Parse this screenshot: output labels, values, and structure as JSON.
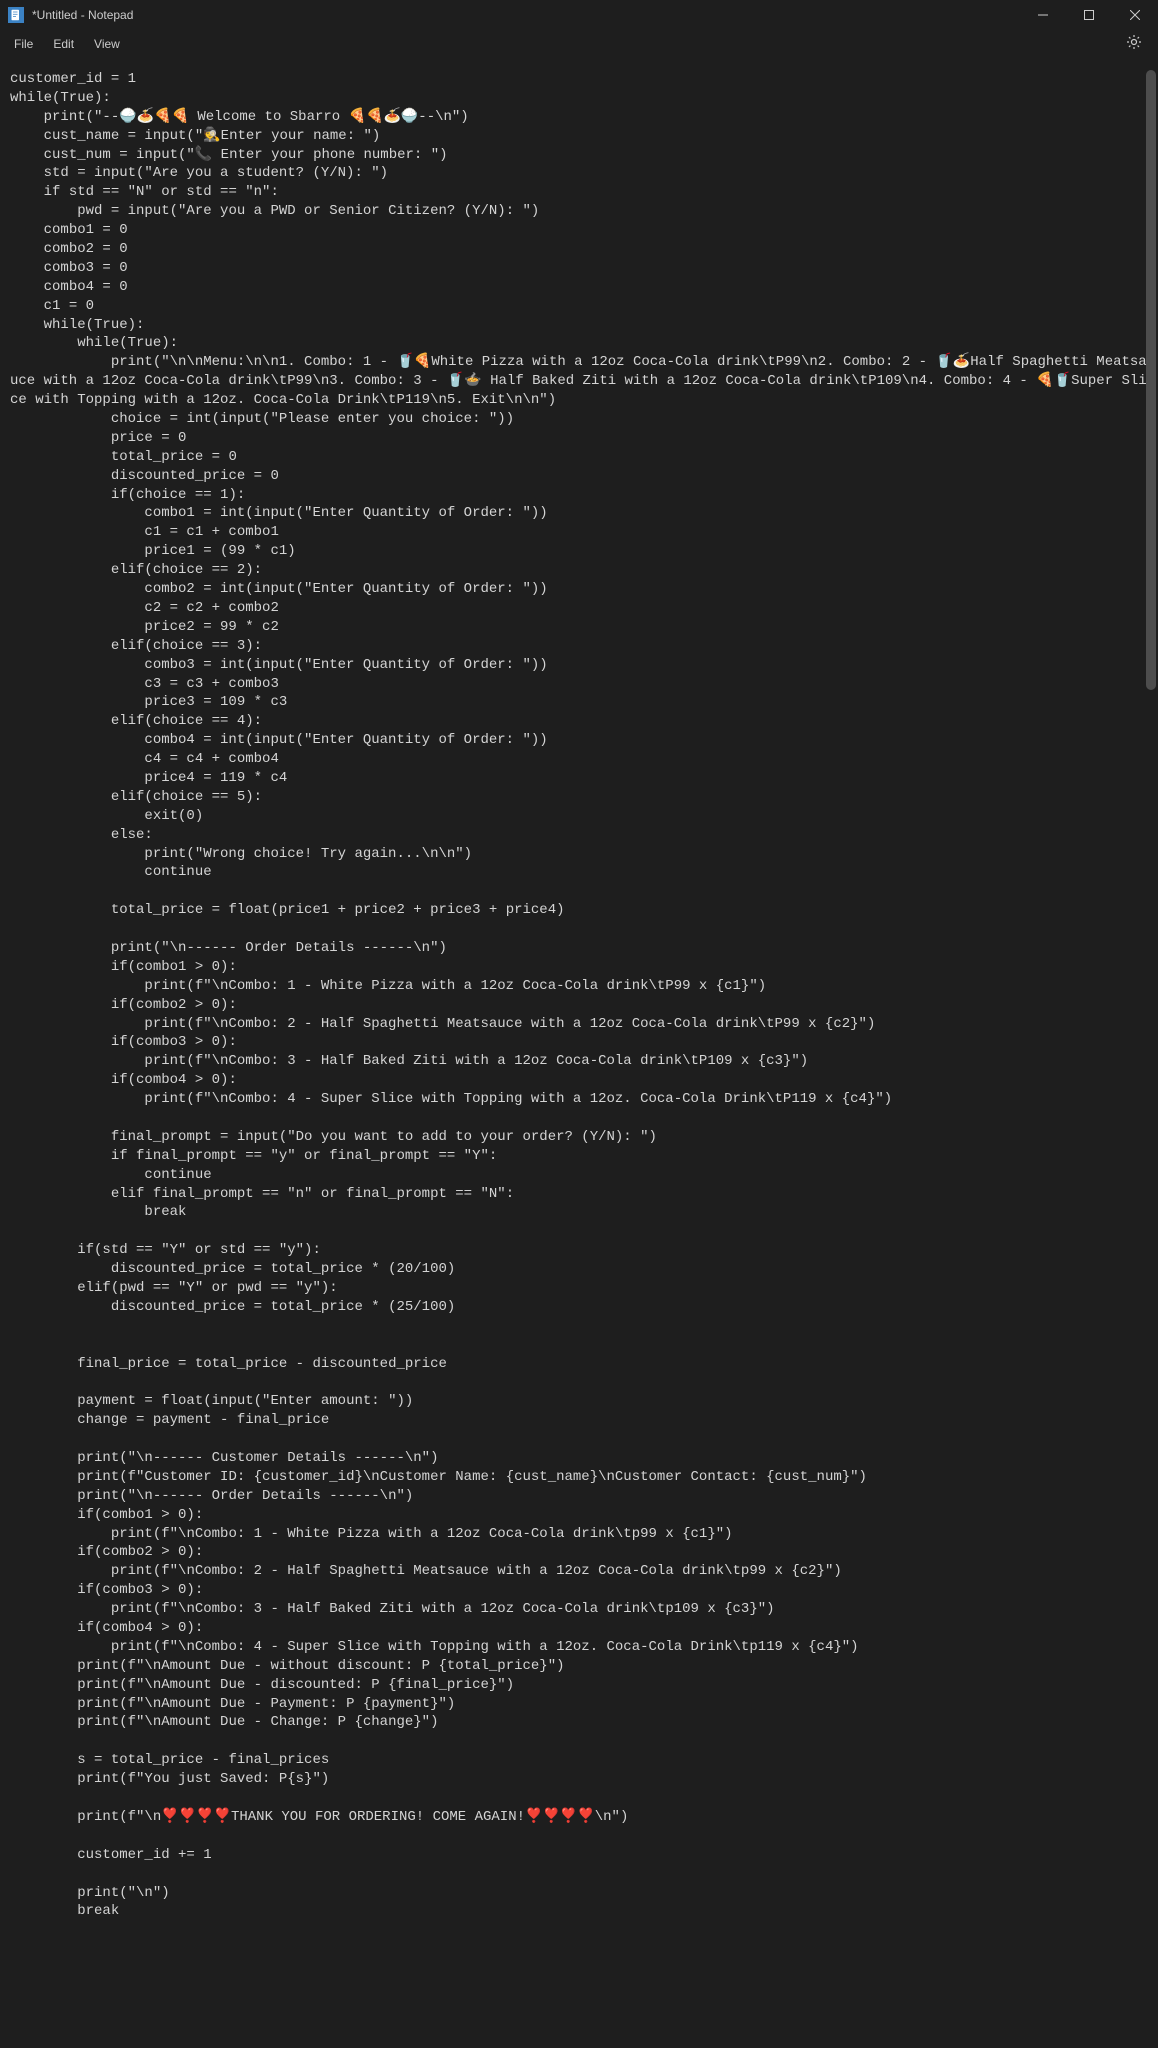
{
  "window": {
    "title": "*Untitled - Notepad"
  },
  "menu": {
    "file": "File",
    "edit": "Edit",
    "view": "View"
  },
  "code": {
    "l1": "customer_id = 1",
    "l2": "while(True):",
    "l3": "    print(\"--🍚🍝🍕🍕 Welcome to Sbarro 🍕🍕🍝🍚--\\n\")",
    "l4": "    cust_name = input(\"🕵️Enter your name: \")",
    "l5": "    cust_num = input(\"📞 Enter your phone number: \")",
    "l6": "    std = input(\"Are you a student? (Y/N): \")",
    "l7": "    if std == \"N\" or std == \"n\":",
    "l8": "        pwd = input(\"Are you a PWD or Senior Citizen? (Y/N): \")",
    "l9": "    combo1 = 0",
    "l10": "    combo2 = 0",
    "l11": "    combo3 = 0",
    "l12": "    combo4 = 0",
    "l13": "    c1 = 0",
    "l14": "    while(True):",
    "l15": "        while(True):",
    "l16": "            print(\"\\n\\nMenu:\\n\\n1. Combo: 1 - 🥤🍕White Pizza with a 12oz Coca-Cola drink\\tP99\\n2. Combo: 2 - 🥤🍝Half Spaghetti Meatsauce with a 12oz Coca-Cola drink\\tP99\\n3. Combo: 3 - 🥤🍲 Half Baked Ziti with a 12oz Coca-Cola drink\\tP109\\n4. Combo: 4 - 🍕🥤Super Slice with Topping with a 12oz. Coca-Cola Drink\\tP119\\n5. Exit\\n\\n\")",
    "l17": "            choice = int(input(\"Please enter you choice: \"))",
    "l18": "            price = 0",
    "l19": "            total_price = 0",
    "l20": "            discounted_price = 0",
    "l21": "            if(choice == 1):",
    "l22": "                combo1 = int(input(\"Enter Quantity of Order: \"))",
    "l23": "                c1 = c1 + combo1",
    "l24": "                price1 = (99 * c1)",
    "l25": "            elif(choice == 2):",
    "l26": "                combo2 = int(input(\"Enter Quantity of Order: \"))",
    "l27": "                c2 = c2 + combo2",
    "l28": "                price2 = 99 * c2",
    "l29": "            elif(choice == 3):",
    "l30": "                combo3 = int(input(\"Enter Quantity of Order: \"))",
    "l31": "                c3 = c3 + combo3",
    "l32": "                price3 = 109 * c3",
    "l33": "            elif(choice == 4):",
    "l34": "                combo4 = int(input(\"Enter Quantity of Order: \"))",
    "l35": "                c4 = c4 + combo4",
    "l36": "                price4 = 119 * c4",
    "l37": "            elif(choice == 5):",
    "l38": "                exit(0)",
    "l39": "            else:",
    "l40": "                print(\"Wrong choice! Try again...\\n\\n\")",
    "l41": "                continue",
    "l42": "",
    "l43": "            total_price = float(price1 + price2 + price3 + price4)",
    "l44": "",
    "l45": "            print(\"\\n------ Order Details ------\\n\")",
    "l46": "            if(combo1 > 0):",
    "l47": "                print(f\"\\nCombo: 1 - White Pizza with a 12oz Coca-Cola drink\\tP99 x {c1}\")",
    "l48": "            if(combo2 > 0):",
    "l49": "                print(f\"\\nCombo: 2 - Half Spaghetti Meatsauce with a 12oz Coca-Cola drink\\tP99 x {c2}\")",
    "l50": "            if(combo3 > 0):",
    "l51": "                print(f\"\\nCombo: 3 - Half Baked Ziti with a 12oz Coca-Cola drink\\tP109 x {c3}\")",
    "l52": "            if(combo4 > 0):",
    "l53": "                print(f\"\\nCombo: 4 - Super Slice with Topping with a 12oz. Coca-Cola Drink\\tP119 x {c4}\")",
    "l54": "",
    "l55": "            final_prompt = input(\"Do you want to add to your order? (Y/N): \")",
    "l56": "            if final_prompt == \"y\" or final_prompt == \"Y\":",
    "l57": "                continue",
    "l58": "            elif final_prompt == \"n\" or final_prompt == \"N\":",
    "l59": "                break",
    "l60": "",
    "l61": "        if(std == \"Y\" or std == \"y\"):",
    "l62": "            discounted_price = total_price * (20/100)",
    "l63": "        elif(pwd == \"Y\" or pwd == \"y\"):",
    "l64": "            discounted_price = total_price * (25/100)",
    "l65": "",
    "l66": "",
    "l67": "        final_price = total_price - discounted_price",
    "l68": "",
    "l69": "        payment = float(input(\"Enter amount: \"))",
    "l70": "        change = payment - final_price",
    "l71": "",
    "l72": "        print(\"\\n------ Customer Details ------\\n\")",
    "l73": "        print(f\"Customer ID: {customer_id}\\nCustomer Name: {cust_name}\\nCustomer Contact: {cust_num}\")",
    "l74": "        print(\"\\n------ Order Details ------\\n\")",
    "l75": "        if(combo1 > 0):",
    "l76": "            print(f\"\\nCombo: 1 - White Pizza with a 12oz Coca-Cola drink\\tp99 x {c1}\")",
    "l77": "        if(combo2 > 0):",
    "l78": "            print(f\"\\nCombo: 2 - Half Spaghetti Meatsauce with a 12oz Coca-Cola drink\\tp99 x {c2}\")",
    "l79": "        if(combo3 > 0):",
    "l80": "            print(f\"\\nCombo: 3 - Half Baked Ziti with a 12oz Coca-Cola drink\\tp109 x {c3}\")",
    "l81": "        if(combo4 > 0):",
    "l82": "            print(f\"\\nCombo: 4 - Super Slice with Topping with a 12oz. Coca-Cola Drink\\tp119 x {c4}\")",
    "l83": "        print(f\"\\nAmount Due - without discount: P {total_price}\")",
    "l84": "        print(f\"\\nAmount Due - discounted: P {final_price}\")",
    "l85": "        print(f\"\\nAmount Due - Payment: P {payment}\")",
    "l86": "        print(f\"\\nAmount Due - Change: P {change}\")",
    "l87": "",
    "l88": "        s = total_price - final_prices",
    "l89": "        print(f\"You just Saved: P{s}\")",
    "l90": "",
    "l91": "        print(f\"\\n❣️❣️❣️❣️THANK YOU FOR ORDERING! COME AGAIN!❣️❣️❣️❣️\\n\")",
    "l92": "",
    "l93": "        customer_id += 1",
    "l94": "",
    "l95": "        print(\"\\n\")",
    "l96": "        break"
  },
  "scrollbar": {
    "thumb_top": 0,
    "thumb_height": 620
  }
}
